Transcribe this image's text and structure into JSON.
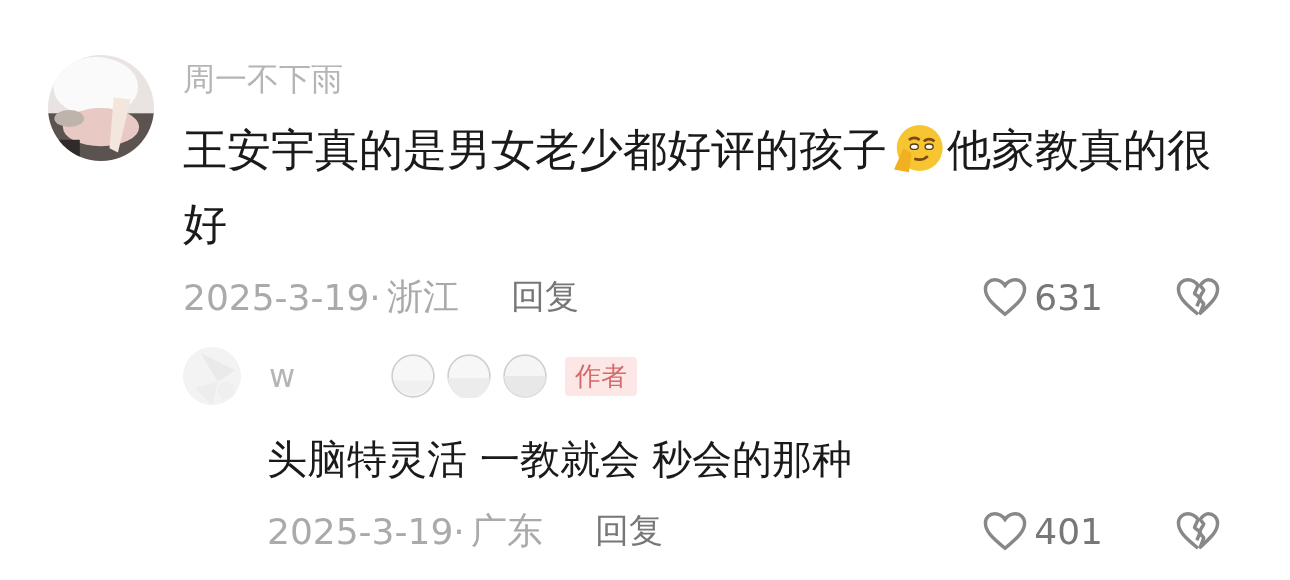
{
  "comment": {
    "username": "周一不下雨",
    "text_before": "王安宇真的是男女老少都好评的孩子",
    "text_after": "他家教真的很好",
    "date": "2025-3-19·",
    "location": "浙江",
    "reply_label": "回复",
    "likes": "631",
    "replies": [
      {
        "username": "w",
        "author_tag": "作者",
        "text": "头脑特灵活 一教就会 秒会的那种",
        "date": "2025-3-19·",
        "location": "广东",
        "reply_label": "回复",
        "likes": "401"
      }
    ]
  }
}
